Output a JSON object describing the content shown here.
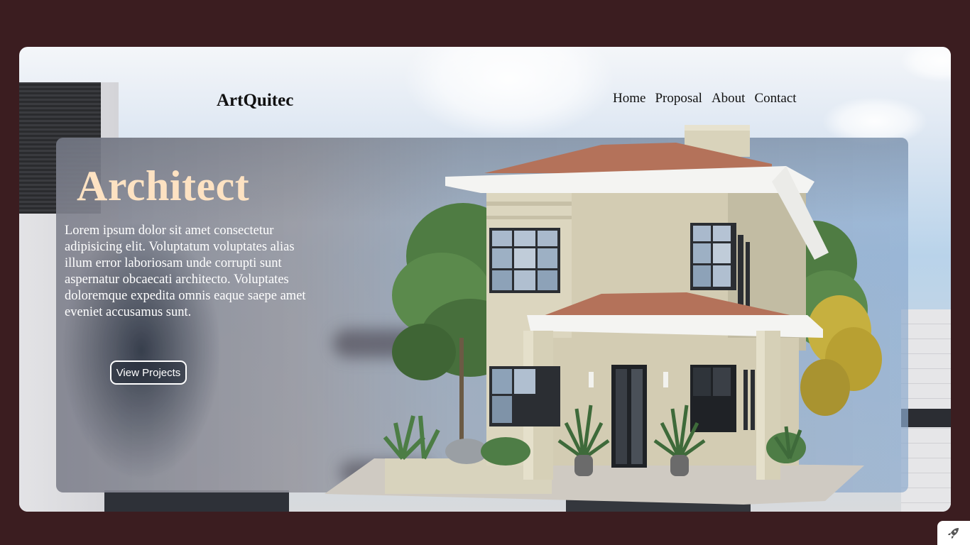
{
  "header": {
    "logo": "ArtQuitec",
    "nav": [
      "Home",
      "Proposal",
      "About",
      "Contact"
    ]
  },
  "hero": {
    "title": "Architect",
    "body": "Lorem ipsum dolor sit amet consectetur adipisicing elit. Voluptatum voluptates alias illum error laboriosam unde corrupti sunt aspernatur obcaecati architecto. Voluptates doloremque expedita omnis eaque saepe amet eveniet accusamus sunt.",
    "cta_label": "View Projects",
    "image": "two-story-house-illustration"
  },
  "colors": {
    "page_background": "#3b1d20",
    "title_color": "#fde2c2",
    "roof_tile": "#b4725a",
    "wall": "#d9d4bd"
  },
  "icons": {
    "corner_widget": "rocket-icon"
  }
}
